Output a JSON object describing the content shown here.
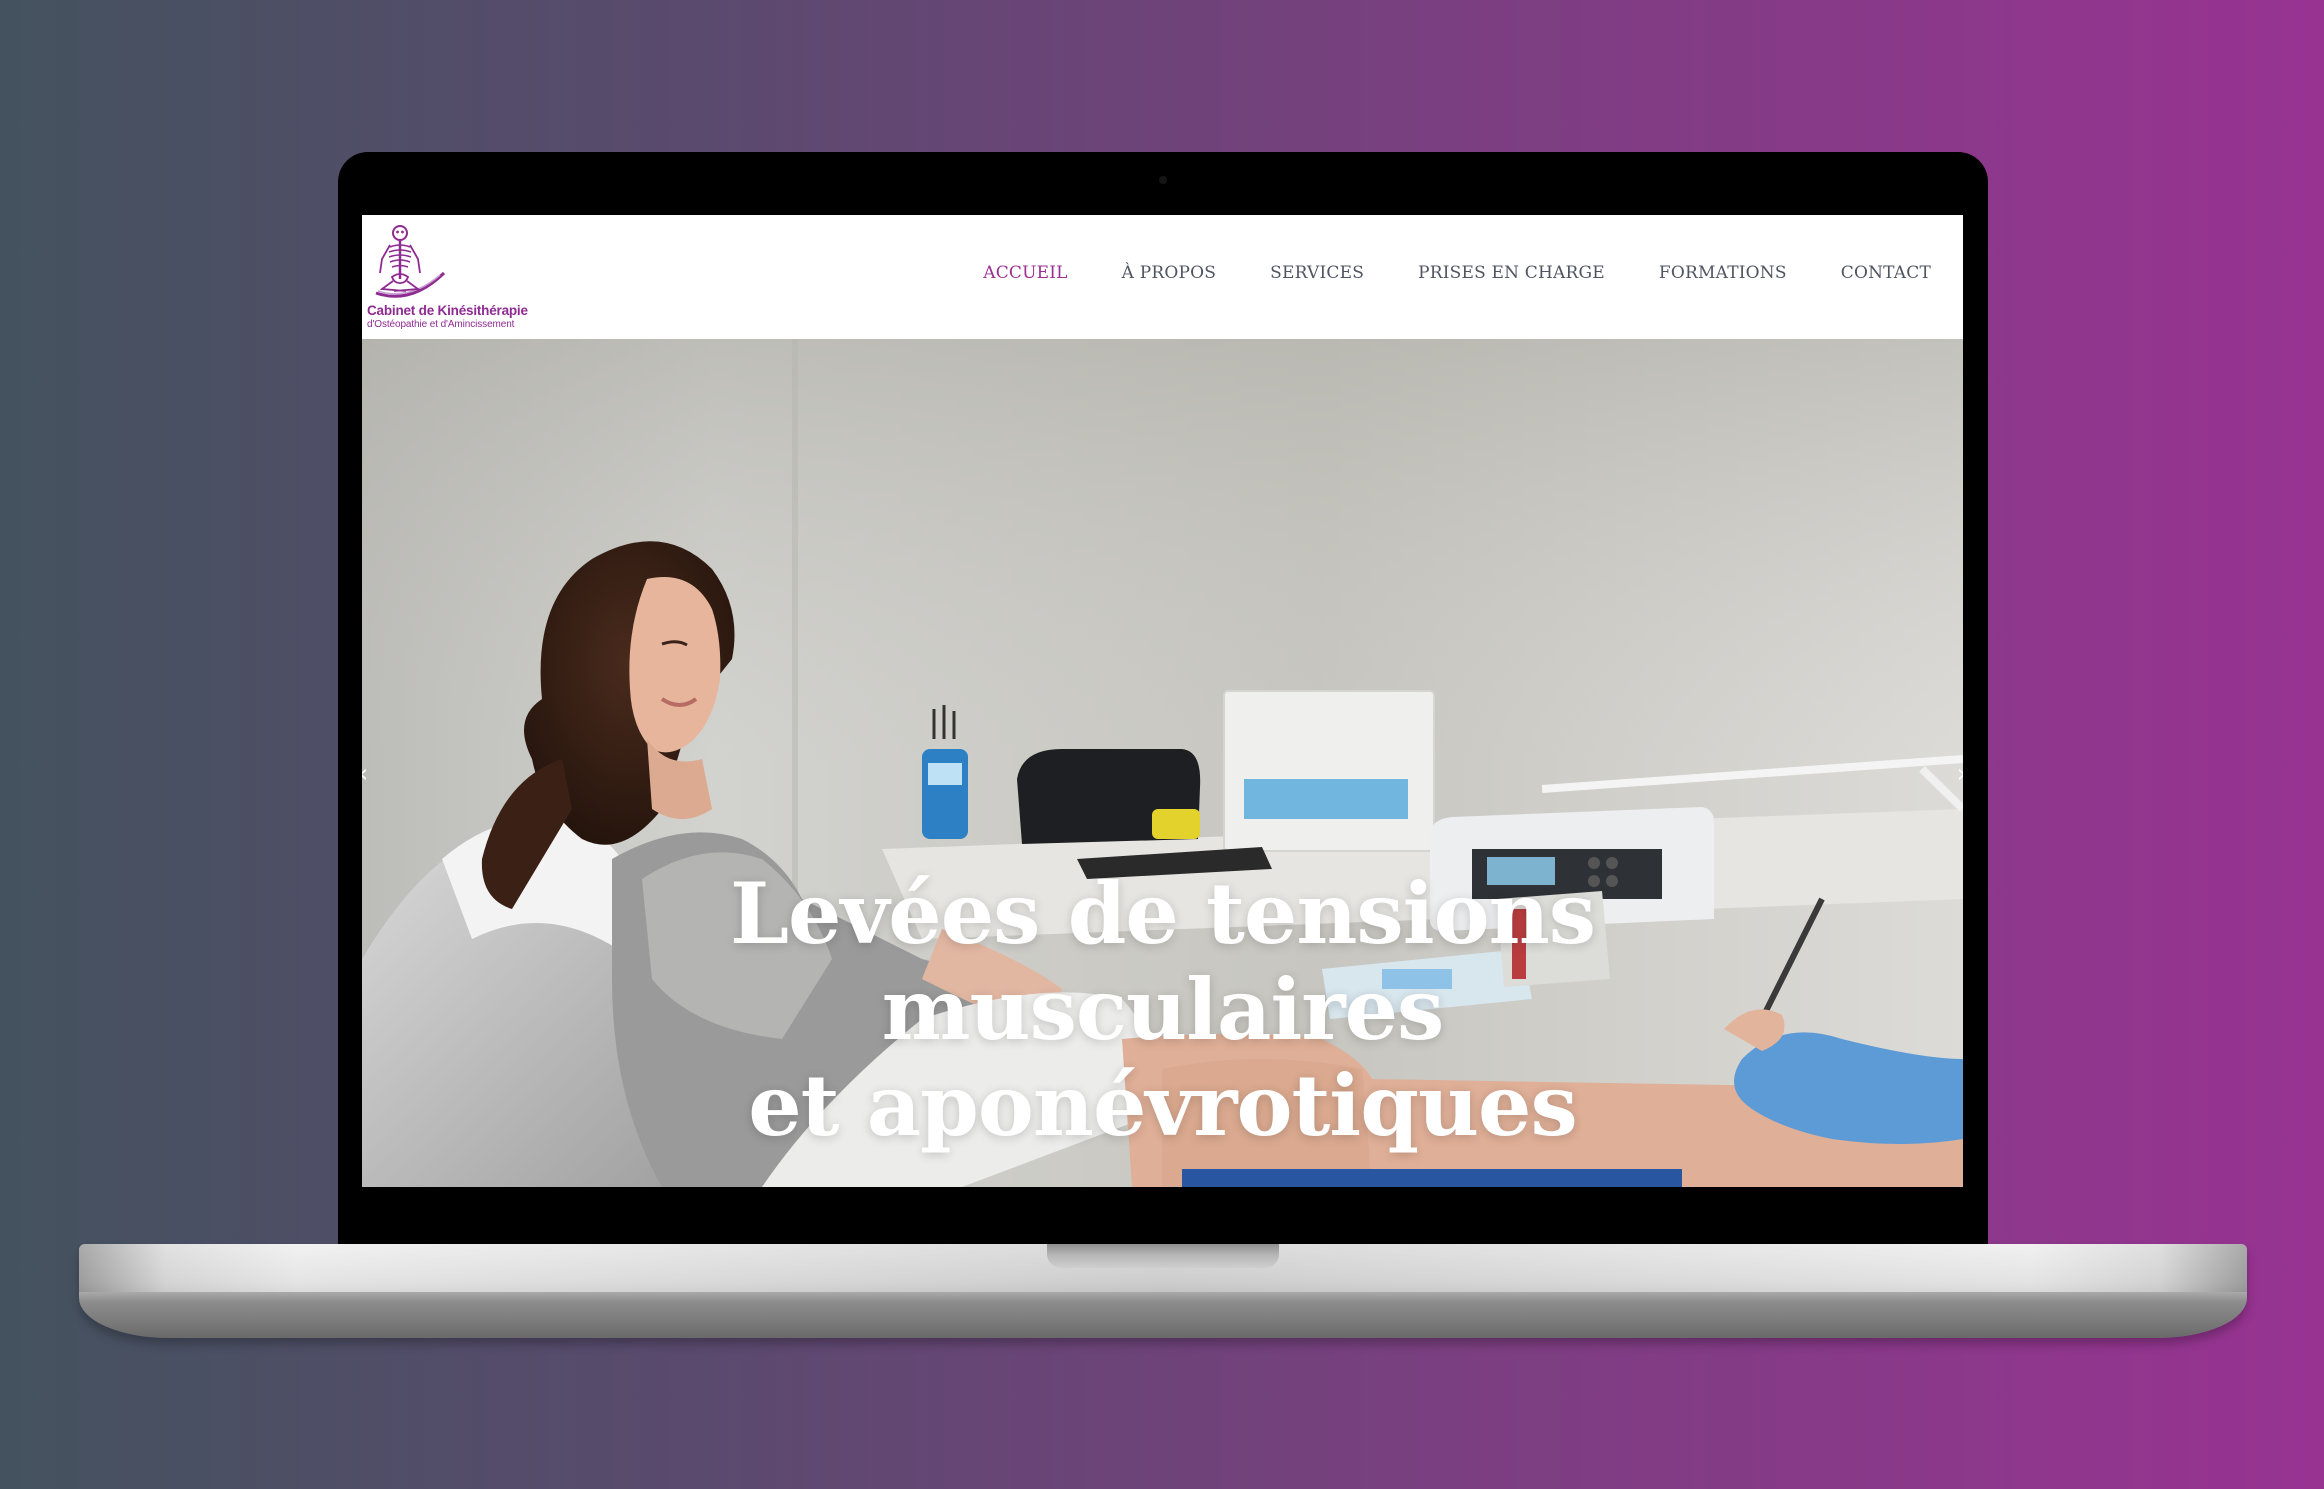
{
  "header": {
    "logo": {
      "title": "Cabinet de Kinésithérapie",
      "subtitle": "d'Ostéopathie et d'Amincissement",
      "icon": "skeleton-logo-icon"
    },
    "nav": [
      {
        "label": "ACCUEIL",
        "active": true
      },
      {
        "label": "À PROPOS",
        "active": false
      },
      {
        "label": "SERVICES",
        "active": false
      },
      {
        "label": "PRISES EN CHARGE",
        "active": false
      },
      {
        "label": "FORMATIONS",
        "active": false
      },
      {
        "label": "CONTACT",
        "active": false
      }
    ]
  },
  "hero": {
    "title_lines": [
      "Levées de tensions",
      "musculaires",
      "et aponévrotiques"
    ],
    "prev_icon": "chevron-left-icon",
    "next_icon": "chevron-right-icon"
  },
  "colors": {
    "accent": "#9b2f93",
    "nav_text": "#4f5560",
    "background_left": "#44525f",
    "background_right": "#983392"
  }
}
